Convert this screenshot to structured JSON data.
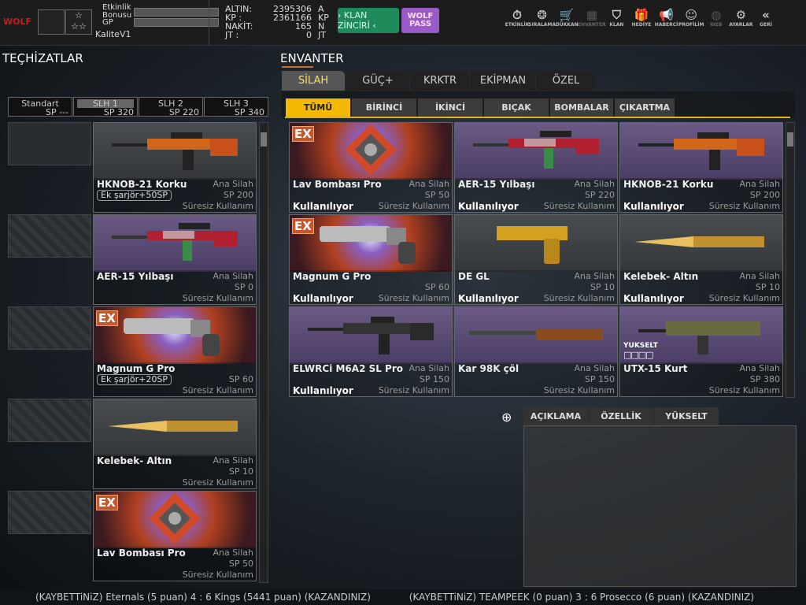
{
  "header": {
    "bonus_label": "Etkinlik Bonusu",
    "gp_label": "GP",
    "quality": "KaliteV1",
    "currencies": [
      {
        "label": "ALTIN:",
        "value": "2395306",
        "unit": "A"
      },
      {
        "label": "KP :",
        "value": "2361166",
        "unit": "KP"
      },
      {
        "label": "NAKİT:",
        "value": "165",
        "unit": "N"
      },
      {
        "label": "JT :",
        "value": "0",
        "unit": "JT"
      }
    ],
    "klan_button": "› KLAN ZİNCİRİ ‹",
    "wolf_button": "WOLF PASS",
    "nav": [
      {
        "label": "ETKİNLİK",
        "icon": "⏱"
      },
      {
        "label": "SIRALAMA",
        "icon": "❂"
      },
      {
        "label": "DÜKKAN",
        "icon": "🛒"
      },
      {
        "label": "ENVANTER",
        "icon": "▦",
        "disabled": true
      },
      {
        "label": "KLAN",
        "icon": "⛉"
      },
      {
        "label": "HEDİYE",
        "icon": "🎁"
      },
      {
        "label": "HABERCİ",
        "icon": "📢"
      },
      {
        "label": "PROFİLİM",
        "icon": "☺"
      },
      {
        "label": "WEB",
        "icon": "◍",
        "disabled": true
      },
      {
        "label": "AYARLAR",
        "icon": "⚙"
      },
      {
        "label": "GERİ",
        "icon": "«"
      }
    ]
  },
  "left": {
    "title": "TEÇHİZATLAR",
    "loadouts": [
      {
        "name": "Standart",
        "sp": "SP ---"
      },
      {
        "name": "SLH 1",
        "sp": "SP 320",
        "active": true
      },
      {
        "name": "SLH 2",
        "sp": "SP 220"
      },
      {
        "name": "SLH 3",
        "sp": "SP 340"
      }
    ],
    "slots": [
      {
        "name": "HKNOB-21 Korku",
        "type": "Ana Silah",
        "sp": "SP 200",
        "duration": "Süresiz Kullanım",
        "extra": "Ek şarjör+50SP",
        "bg": "grey",
        "gun": "rifle-orange"
      },
      {
        "name": "AER-15 Yılbaşı",
        "type": "Ana Silah",
        "sp": "SP 0",
        "duration": "Süresiz Kullanım",
        "bg": "purple",
        "gun": "rifle-red"
      },
      {
        "name": "Magnum G Pro",
        "type": "",
        "sp": "SP 60",
        "duration": "Süresiz Kullanım",
        "extra": "Ek şarjör+20SP",
        "ex": "EX",
        "bg": "fire",
        "gun": "revolver"
      },
      {
        "name": "Kelebek- Altın",
        "type": "Ana Silah",
        "sp": "SP 10",
        "duration": "Süresiz Kullanım",
        "bg": "grey",
        "gun": "knife"
      },
      {
        "name": "Lav Bombası Pro",
        "type": "Ana Silah",
        "sp": "SP 50",
        "duration": "Süresiz Kullanım",
        "ex": "EX",
        "bg": "fire",
        "gun": "grenade"
      }
    ]
  },
  "inventory": {
    "title": "ENVANTER",
    "tabs": [
      {
        "label": "SİLAH",
        "active": true
      },
      {
        "label": "GÜÇ+"
      },
      {
        "label": "KRKTR"
      },
      {
        "label": "EKİPMAN"
      },
      {
        "label": "ÖZEL"
      }
    ],
    "subtabs": [
      {
        "label": "TÜMÜ",
        "active": true
      },
      {
        "label": "BİRİNCİ"
      },
      {
        "label": "İKİNCİ"
      },
      {
        "label": "BIÇAK"
      },
      {
        "label": "BOMBALAR"
      },
      {
        "label": "ÇIKARTMA"
      }
    ],
    "items": [
      {
        "name": "Lav Bombası Pro",
        "type": "Ana Silah",
        "sp": "SP 50",
        "status": "Kullanılıyor",
        "duration": "Süresiz Kullanım",
        "ex": "EX",
        "bg": "fire",
        "gun": "grenade"
      },
      {
        "name": "AER-15 Yılbaşı",
        "type": "Ana Silah",
        "sp": "SP 220",
        "status": "Kullanılıyor",
        "duration": "Süresiz Kullanım",
        "bg": "purple",
        "gun": "rifle-red"
      },
      {
        "name": "HKNOB-21 Korku",
        "type": "Ana Silah",
        "sp": "SP 200",
        "status": "Kullanılıyor",
        "duration": "Süresiz Kullanım",
        "bg": "purple",
        "gun": "rifle-orange"
      },
      {
        "name": "Magnum G Pro",
        "type": "",
        "sp": "SP 60",
        "status": "Kullanılıyor",
        "duration": "Süresiz Kullanım",
        "ex": "EX",
        "bg": "fire",
        "gun": "revolver"
      },
      {
        "name": "DE GL",
        "type": "Ana Silah",
        "sp": "SP 10",
        "status": "Kullanılıyor",
        "duration": "Süresiz Kullanım",
        "bg": "grey",
        "gun": "pistol"
      },
      {
        "name": "Kelebek- Altın",
        "type": "Ana Silah",
        "sp": "SP 10",
        "status": "Kullanılıyor",
        "duration": "Süresiz Kullanım",
        "bg": "grey",
        "gun": "knife"
      },
      {
        "name": "ELWRCi M6A2 SL Pro",
        "type": "Ana Silah",
        "sp": "SP 150",
        "status": "Kullanılıyor",
        "duration": "Süresiz Kullanım",
        "bg": "purple",
        "gun": "rifle-black"
      },
      {
        "name": "Kar 98K çöl",
        "type": "Ana Silah",
        "sp": "SP 150",
        "duration": "Süresiz Kullanım",
        "bg": "purple",
        "gun": "sniper"
      },
      {
        "name": "UTX-15 Kurt",
        "type": "Ana Silah",
        "sp": "SP 380",
        "duration": "Süresiz Kullanım",
        "upgrade": "YUKSELT",
        "bg": "purple",
        "gun": "rifle-camo"
      }
    ]
  },
  "detail": {
    "tabs": [
      "AÇIKLAMA",
      "ÖZELLİK",
      "YÜKSELT"
    ]
  },
  "ticker": [
    "(KAYBETTiNiZ) Eternals (5 puan) 4 : 6 Kings (5441 puan) (KAZANDINIZ)",
    "(KAYBETTiNiZ) TEAMPEEK (0 puan) 3 : 6 Prosecco (6 puan) (KAZANDINIZ)"
  ]
}
